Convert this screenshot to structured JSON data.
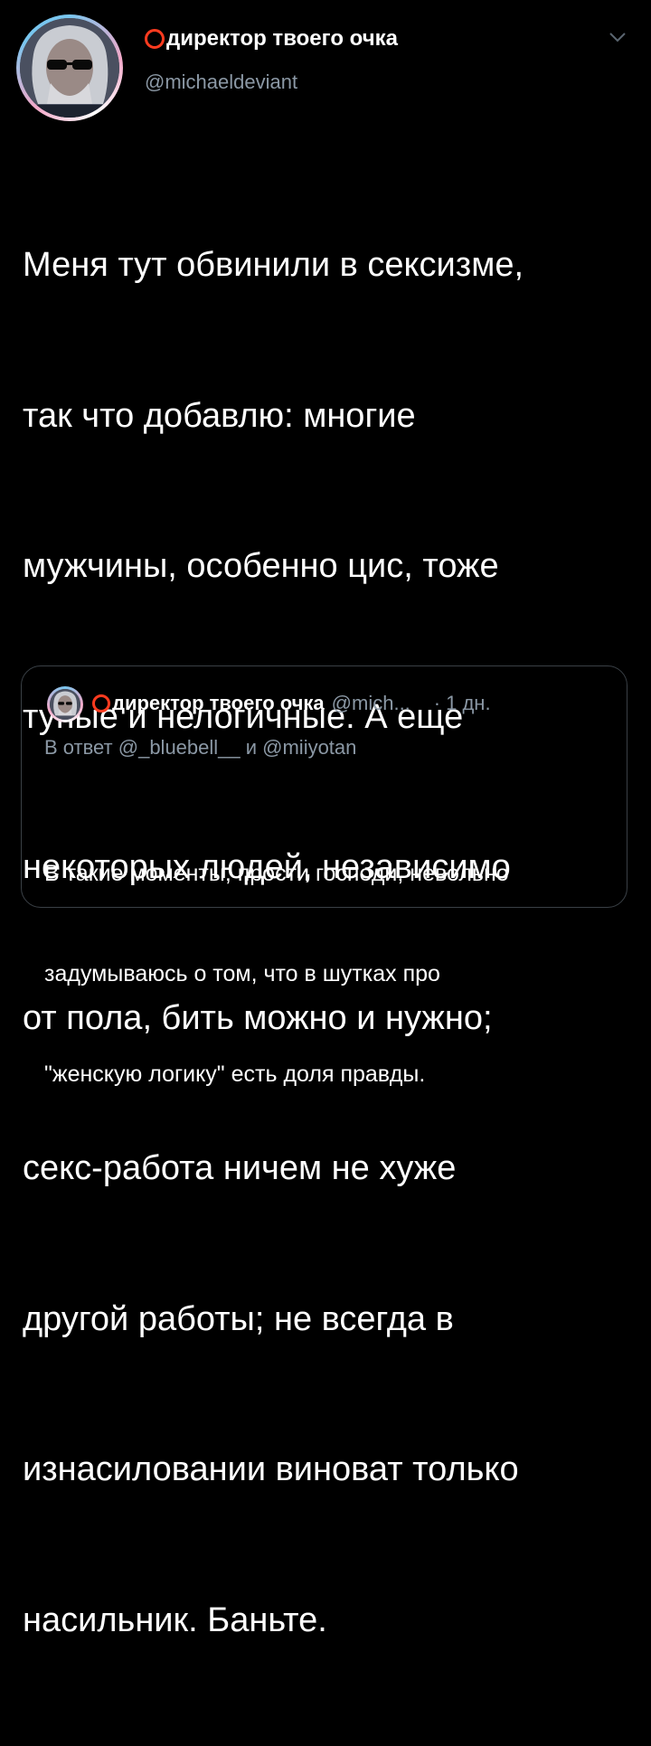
{
  "tweet": {
    "display_name": "директор твоего очка",
    "handle": "@michaeldeviant",
    "text_lines": [
      "Меня тут обвинили в сексизме,",
      "так что добавлю: многие",
      "мужчины, особенно цис, тоже",
      "тупые и нелогичные. А еще",
      "некоторых людей, независимо",
      "от пола, бить можно и нужно;",
      "секс-работа ничем не хуже",
      "другой работы; не всегда в",
      "изнасиловании виноват только",
      "насильник. Баньте."
    ],
    "icons": {
      "name_badge": "red-ring-icon",
      "menu": "chevron-down-icon"
    }
  },
  "quote": {
    "display_name": "директор твоего очка",
    "handle": "@mich...",
    "separator": "·",
    "time": "1 дн.",
    "reply_to": "В ответ @_bluebell__ и @miiyotan",
    "text_lines": [
      "В такие моменты, прости господи, невольно",
      "задумываюсь о том, что в шутках про",
      "\"женскую логику\" есть доля правды."
    ]
  },
  "colors": {
    "background": "#000000",
    "text": "#ffffff",
    "secondary": "#8b98a5",
    "badge": "#ff3b1f",
    "border": "#3a4046"
  }
}
